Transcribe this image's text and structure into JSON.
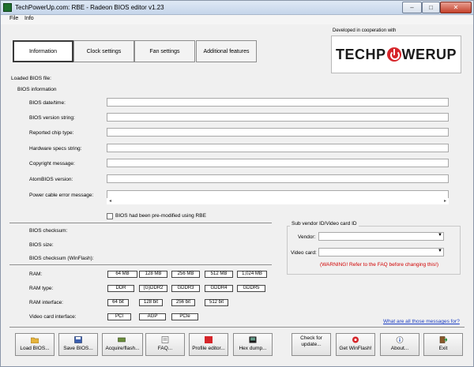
{
  "window": {
    "title": "TechPowerUp.com: RBE - Radeon BIOS editor v1.23",
    "min": "–",
    "max": "□",
    "close": "✕"
  },
  "menu": [
    "File",
    "Info"
  ],
  "tabs": [
    "Information",
    "Clock settings",
    "Fan settings",
    "Additional features"
  ],
  "branding": {
    "developed": "Developed in cooperation with",
    "logo_left": "TECHP",
    "logo_right": "WERUP"
  },
  "loaded_bios_label": "Loaded BIOS file:",
  "bios_info_label": "BIOS information",
  "fields": [
    {
      "label": "BIOS date/time:",
      "value": ""
    },
    {
      "label": "BIOS version string:",
      "value": ""
    },
    {
      "label": "Reported chip type:",
      "value": ""
    },
    {
      "label": "Hardware specs string:",
      "value": ""
    },
    {
      "label": "Copyright message:",
      "value": ""
    },
    {
      "label": "AtomBIOS version:",
      "value": ""
    },
    {
      "label": "Power cable error message:",
      "value": ""
    }
  ],
  "premodified_label": "BIOS had been pre-modified using RBE",
  "premodified_checked": false,
  "checksum_label": "BIOS checksum:",
  "size_label": "BIOS size:",
  "checksum_winflash_label": "BIOS checksum (WinFlash):",
  "ram": {
    "label": "RAM:",
    "options": [
      "64 MB",
      "128 MB",
      "256 MB",
      "512 MB",
      "1,024 MB"
    ]
  },
  "ram_type": {
    "label": "RAM type:",
    "options": [
      "DDR",
      "(G)DDR2",
      "GDDR3",
      "GDDR4",
      "GDDR5"
    ]
  },
  "ram_interface": {
    "label": "RAM interface:",
    "options": [
      "64 bit",
      "128 bit",
      "256 bit",
      "512 bit"
    ]
  },
  "video_interface": {
    "label": "Video card interface:",
    "options": [
      "PCI",
      "AGP",
      "PCIe"
    ]
  },
  "subvendor": {
    "title": "Sub vendor ID/Video card ID",
    "vendor_label": "Vendor:",
    "vendor_value": "",
    "card_label": "Video card:",
    "card_value": "",
    "warning": "(WARNING! Refer to the FAQ before changing this!)"
  },
  "messages_link": "What are all those messages for?",
  "buttons": [
    {
      "label": "Load BIOS...",
      "icon": "folder-icon"
    },
    {
      "label": "Save BIOS...",
      "icon": "save-icon"
    },
    {
      "label": "Acquire/flash...",
      "icon": "card-icon"
    },
    {
      "label": "FAQ...",
      "icon": "faq-icon"
    },
    {
      "label": "Profile editor...",
      "icon": "ati-icon"
    },
    {
      "label": "Hex dump...",
      "icon": "hex-icon"
    },
    {
      "label": "Check for update...",
      "icon": ""
    },
    {
      "label": "Get WinFlash!",
      "icon": "winflash-icon"
    },
    {
      "label": "About...",
      "icon": "info-icon"
    },
    {
      "label": "Exit",
      "icon": "exit-icon"
    }
  ],
  "colors": {
    "warning": "#d10000",
    "link": "#1a3dc4",
    "brand_red": "#d6252a"
  }
}
